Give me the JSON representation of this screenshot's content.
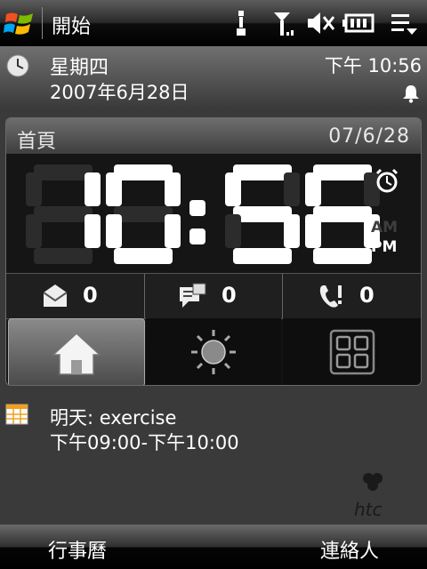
{
  "title_bar": {
    "start_label": "開始",
    "icons": [
      "start-flag-icon",
      "data-connection-icon",
      "signal-icon",
      "speaker-muted-icon",
      "battery-icon",
      "ok-menu-icon"
    ]
  },
  "clock_bar": {
    "weekday": "星期四",
    "date": "2007年6月28日",
    "time": "下午 10:56",
    "icons": [
      "clock-icon",
      "alarm-bell-icon"
    ]
  },
  "widget": {
    "home_label": "首頁",
    "date": "07/6/28",
    "time_digits": "10:56",
    "am_label": "AM",
    "pm_label": "PM",
    "meridiem": "PM",
    "counters": [
      {
        "icon": "email-icon",
        "value": "0"
      },
      {
        "icon": "sms-icon",
        "value": "0"
      },
      {
        "icon": "missed-call-icon",
        "value": "0"
      }
    ],
    "tabs": [
      {
        "icon": "home-icon",
        "selected": true
      },
      {
        "icon": "weather-sun-icon",
        "selected": false
      },
      {
        "icon": "launcher-grid-icon",
        "selected": false
      }
    ]
  },
  "appointment": {
    "title": "明天: exercise",
    "time": "下午09:00-下午10:00",
    "icon": "calendar-icon"
  },
  "softkeys": {
    "left": "行事曆",
    "right": "連絡人"
  },
  "colors": {
    "digit_lit": "#ffffff",
    "digit_unlit": "#2c2c2c",
    "widget_bg": "#151515"
  }
}
